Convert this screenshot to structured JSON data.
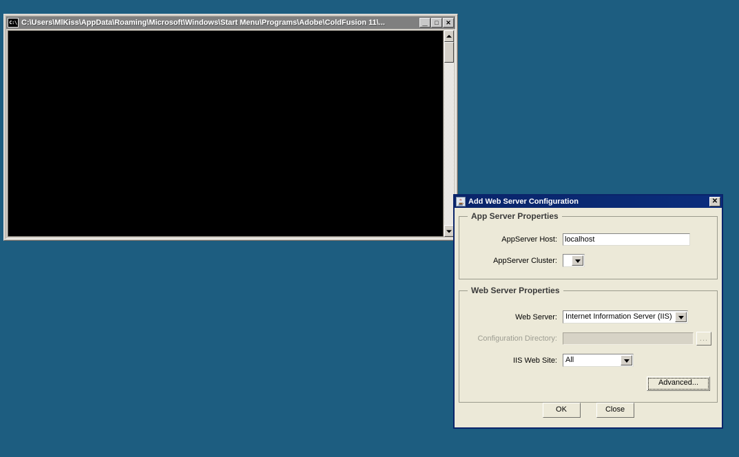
{
  "desktop": {
    "background_color": "#1d5d80"
  },
  "console_window": {
    "title": "C:\\Users\\MlKiss\\AppData\\Roaming\\Microsoft\\Windows\\Start Menu\\Programs\\Adobe\\ColdFusion 11\\...",
    "icon_label": "C:\\",
    "screen_text": "",
    "screen_color": "#000000",
    "titlebar_color": "#7f7f7f",
    "controls": {
      "minimize": "_",
      "maximize": "□",
      "close": "✕"
    },
    "scrollbar": {
      "up_arrow": "up-arrow",
      "down_arrow": "down-arrow"
    }
  },
  "dialog": {
    "title": "Add Web Server Configuration",
    "titlebar_color": "#0a246a",
    "icon": "java-coffee-cup-icon",
    "close_label": "✕",
    "app_server_group": {
      "title": "App Server Properties",
      "fields": [
        {
          "label": "AppServer Host:",
          "type": "textbox",
          "value": "localhost",
          "placeholder": "",
          "disabled": false
        },
        {
          "label": "AppServer Cluster:",
          "type": "combobox",
          "value": "",
          "disabled": false
        }
      ]
    },
    "web_server_group": {
      "title": "Web Server Properties",
      "fields": [
        {
          "label": "Web Server:",
          "type": "combobox",
          "value": "Internet Information Server (IIS)",
          "disabled": false
        },
        {
          "label": "Configuration Directory:",
          "type": "textbox",
          "value": "",
          "placeholder": "",
          "disabled": true,
          "browse_label": "..."
        },
        {
          "label": "IIS Web Site:",
          "type": "combobox",
          "value": "All",
          "disabled": false
        }
      ],
      "advanced_label": "Advanced..."
    },
    "buttons": {
      "ok_label": "OK",
      "close_label": "Close"
    }
  }
}
